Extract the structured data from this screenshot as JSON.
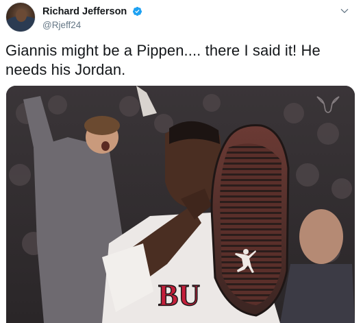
{
  "tweet": {
    "author": {
      "display_name": "Richard Jefferson",
      "handle": "@Rjeff24",
      "verified": true,
      "avatar_icon": "avatar-photo"
    },
    "text": "Giannis might be a Pippen.... there I said it! He needs his Jordan.",
    "menu_icon": "chevron-down-icon",
    "media": {
      "type": "photo",
      "jersey_text": "BU"
    }
  },
  "colors": {
    "verified_blue": "#1da1f2",
    "handle_gray": "#657786",
    "text_dark": "#14171a"
  }
}
